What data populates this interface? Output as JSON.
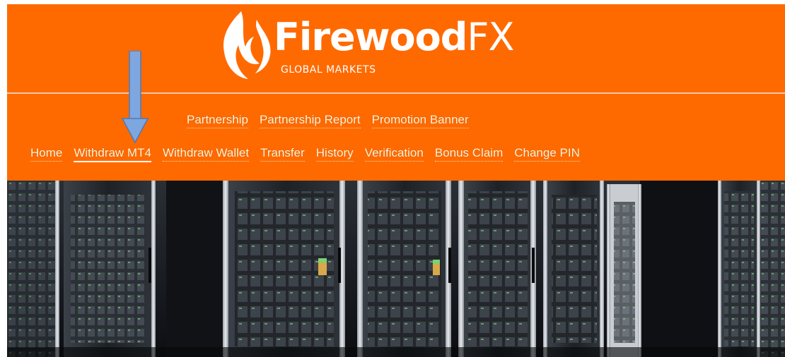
{
  "brand": {
    "name_main": "Firewood",
    "name_suffix": "FX",
    "tagline": "GLOBAL MARKETS",
    "logo_icon": "flame-icon"
  },
  "nav": {
    "row1": [
      {
        "label": "Partnership"
      },
      {
        "label": "Partnership Report"
      },
      {
        "label": "Promotion Banner"
      }
    ],
    "row2": [
      {
        "label": "Home"
      },
      {
        "label": "Withdraw MT4",
        "active": true
      },
      {
        "label": "Withdraw Wallet"
      },
      {
        "label": "Transfer"
      },
      {
        "label": "History"
      },
      {
        "label": "Verification"
      },
      {
        "label": "Bonus Claim"
      },
      {
        "label": "Change PIN"
      }
    ]
  },
  "annotation": {
    "icon": "arrow-down-icon",
    "target": "Withdraw MT4"
  },
  "banner": {
    "image": "server-racks-photo"
  },
  "colors": {
    "brand_orange": "#ff6a00",
    "arrow_blue": "#7ea6df",
    "nav_text": "#fff6d8"
  }
}
